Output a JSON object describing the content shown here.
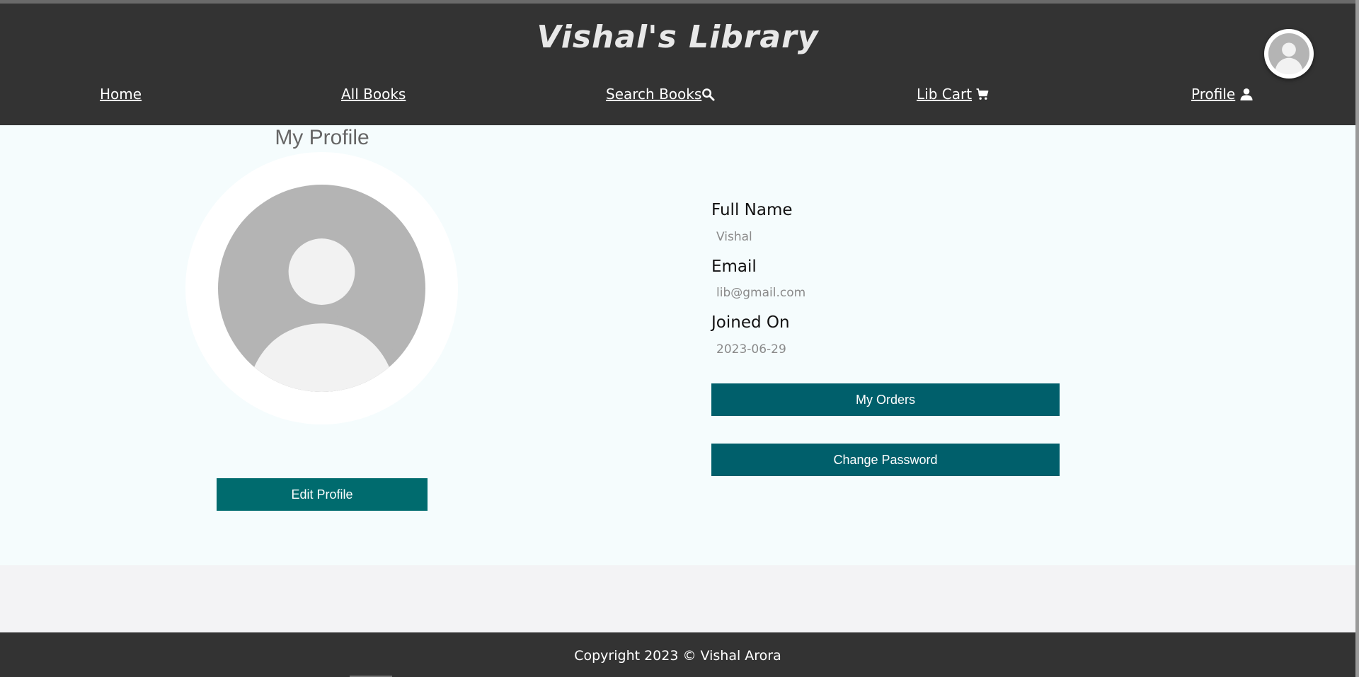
{
  "header": {
    "site_title": "Vishal's Library"
  },
  "nav": {
    "home": "Home",
    "all_books": "All Books",
    "search_books": "Search Books",
    "lib_cart": "Lib Cart",
    "profile": "Profile"
  },
  "profile": {
    "heading": "My Profile",
    "edit_button": "Edit Profile",
    "fields": {
      "full_name_label": "Full Name",
      "full_name_value": "Vishal",
      "email_label": "Email",
      "email_value": "lib@gmail.com",
      "joined_label": "Joined On",
      "joined_value": "2023-06-29"
    },
    "orders_button": "My Orders",
    "password_button": "Change Password"
  },
  "footer": {
    "copyright": "Copyright 2023 © Vishal Arora"
  },
  "colors": {
    "header_bg": "#333333",
    "content_bg": "#f5fcfd",
    "button_teal": "#006b6e",
    "button_dark_teal": "#005f6b"
  },
  "icons": {
    "search": "search-icon",
    "cart": "cart-icon",
    "user": "user-icon",
    "avatar": "avatar-placeholder-icon"
  }
}
